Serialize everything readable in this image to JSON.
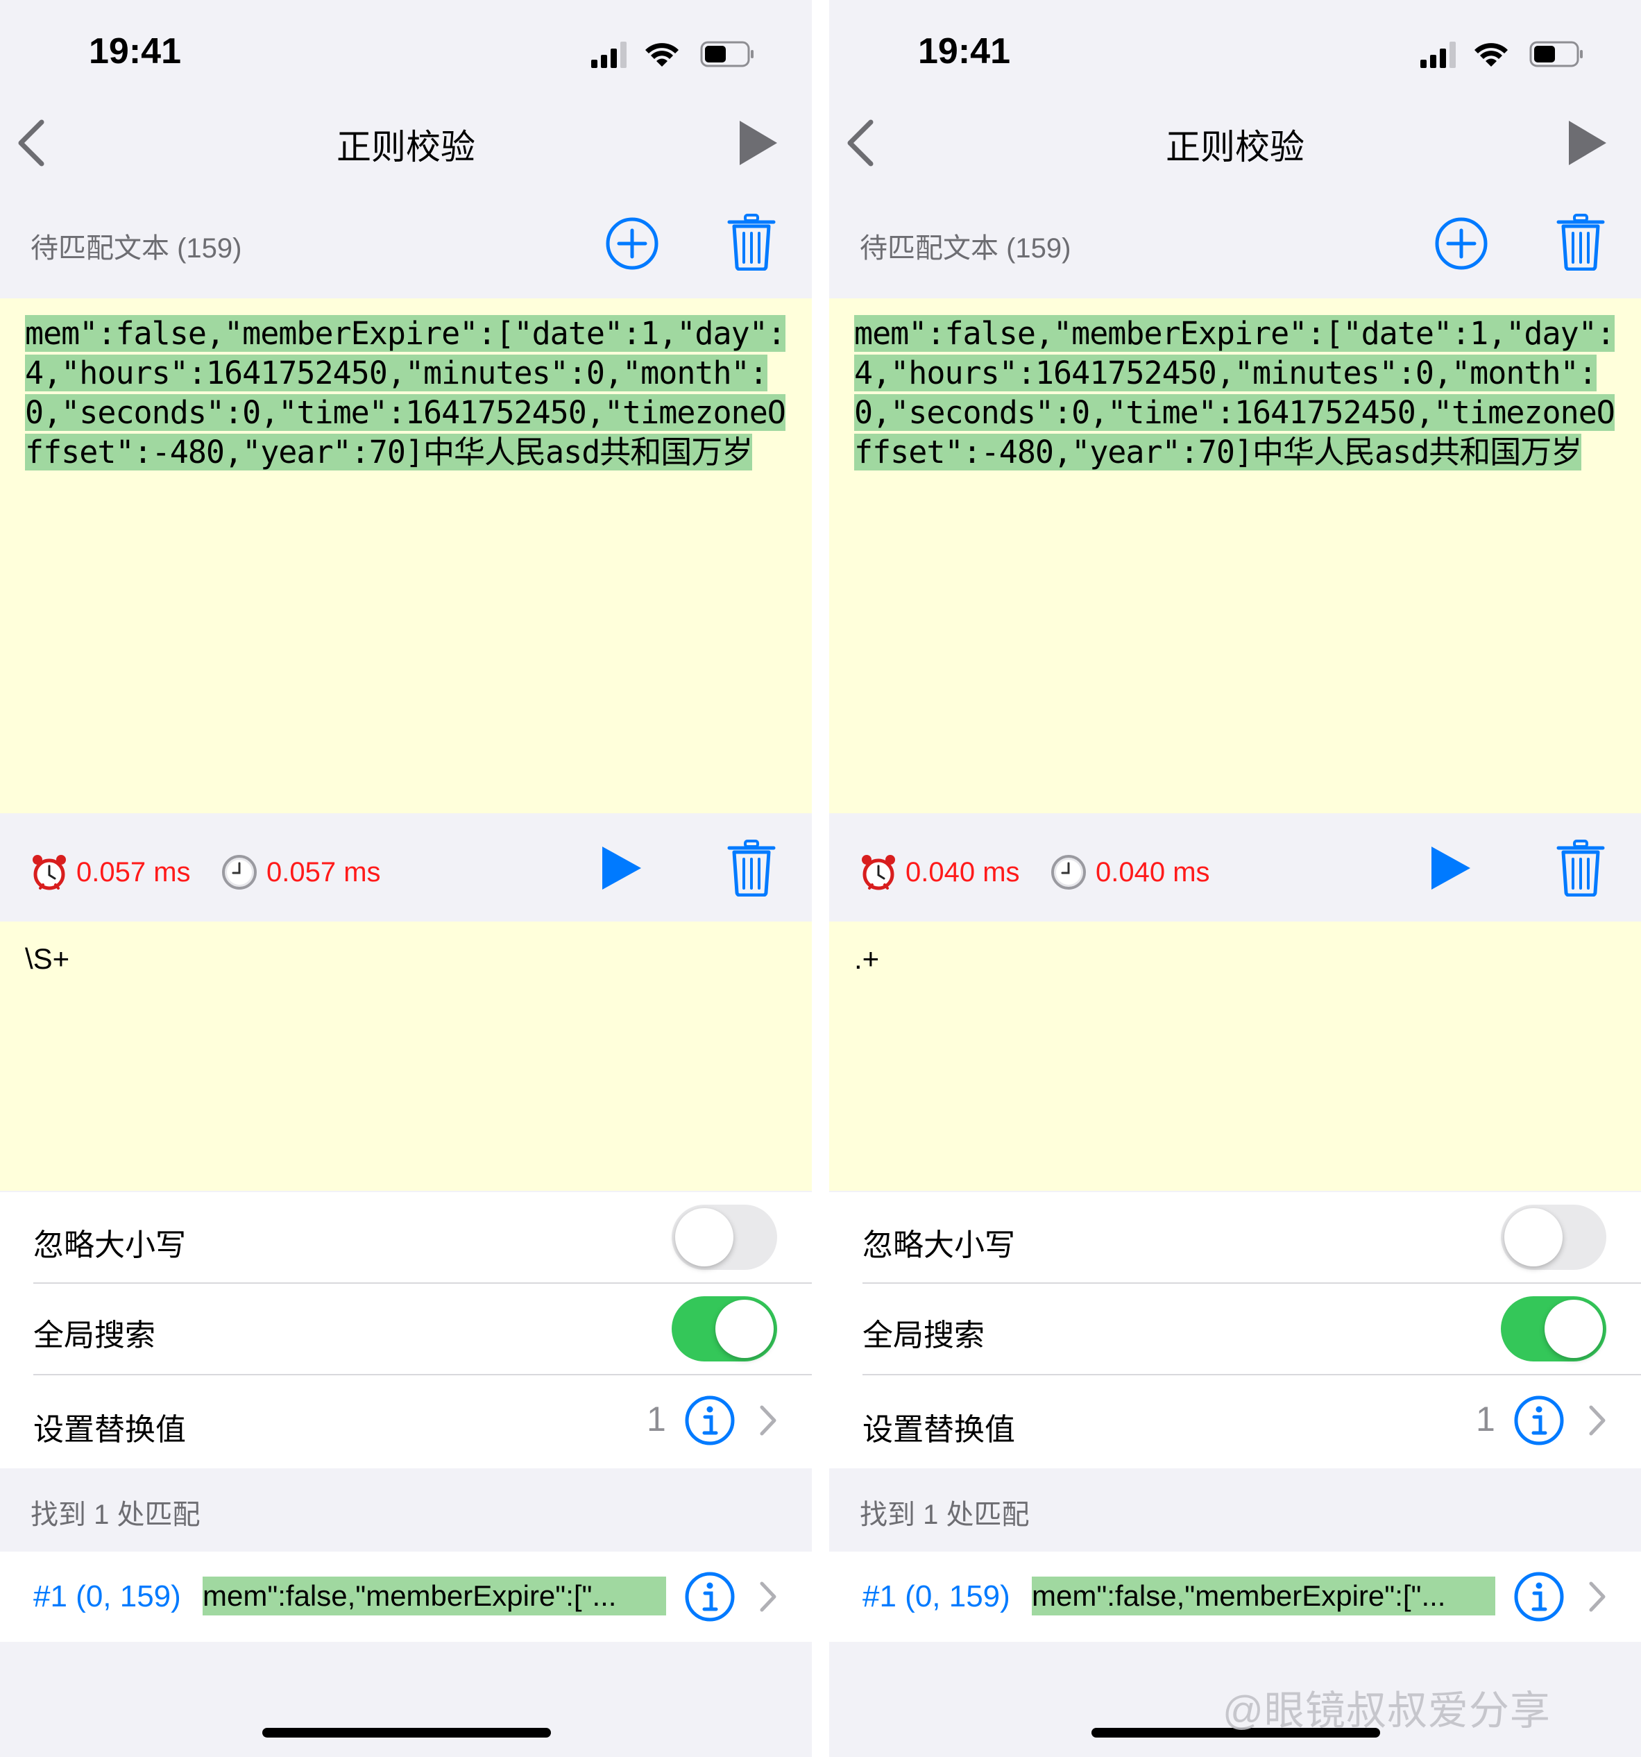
{
  "screens": [
    {
      "status_time": "19:41",
      "nav_title": "正则校验",
      "section_label": "待匹配文本 (159)",
      "target_text": "mem\":false,\"memberExpire\":[\"date\":1,\"day\":4,\"hours\":1641752450,\"minutes\":0,\"month\":0,\"seconds\":0,\"time\":1641752450,\"timezoneOffset\":-480,\"year\":70]中华人民asd共和国万岁",
      "timing_1": "0.057 ms",
      "timing_2": "0.057 ms",
      "regex": "\\S+",
      "ignore_case_label": "忽略大小写",
      "ignore_case_on": false,
      "global_search_label": "全局搜索",
      "global_search_on": true,
      "replace_label": "设置替换值",
      "replace_value": "1",
      "match_count_label": "找到 1 处匹配",
      "match_index": "#1 (0, 159)",
      "match_preview": "mem\":false,\"memberExpire\":[\"..."
    },
    {
      "status_time": "19:41",
      "nav_title": "正则校验",
      "section_label": "待匹配文本 (159)",
      "target_text": "mem\":false,\"memberExpire\":[\"date\":1,\"day\":4,\"hours\":1641752450,\"minutes\":0,\"month\":0,\"seconds\":0,\"time\":1641752450,\"timezoneOffset\":-480,\"year\":70]中华人民asd共和国万岁",
      "timing_1": "0.040 ms",
      "timing_2": "0.040 ms",
      "regex": ".+",
      "ignore_case_label": "忽略大小写",
      "ignore_case_on": false,
      "global_search_label": "全局搜索",
      "global_search_on": true,
      "replace_label": "设置替换值",
      "replace_value": "1",
      "match_count_label": "找到 1 处匹配",
      "match_index": "#1 (0, 159)",
      "match_preview": "mem\":false,\"memberExpire\":[\"..."
    }
  ],
  "watermark": "@眼镜叔叔爱分享",
  "colors": {
    "accent": "#007aff",
    "timing_red": "#ff1a1a",
    "editor_bg": "#ffffdb",
    "match_highlight": "#a0d8a0",
    "toggle_on": "#34c759",
    "toggle_off": "#e9e9eb",
    "grouped_bg": "#f2f2f7"
  },
  "icons": [
    "back-chevron-icon",
    "play-icon",
    "add-circle-icon",
    "trash-icon",
    "alarm-clock-icon",
    "clock-icon",
    "info-icon",
    "chevron-right-icon",
    "signal-icon",
    "wifi-icon",
    "battery-icon"
  ]
}
